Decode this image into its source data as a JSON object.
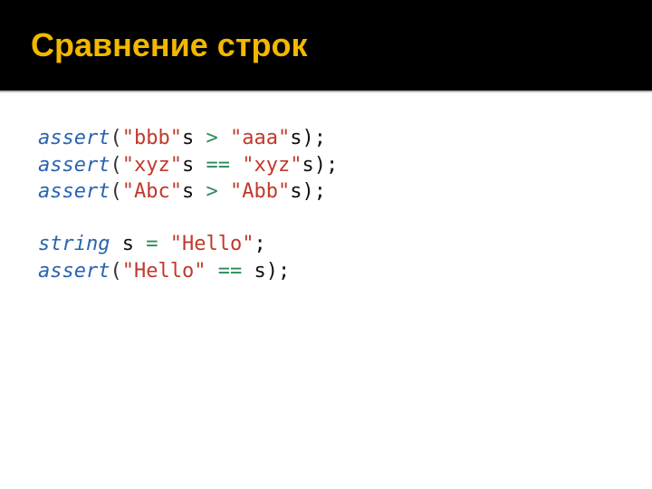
{
  "header": {
    "title": "Сравнение строк"
  },
  "code": {
    "l1": {
      "kw": "assert",
      "p1": "(",
      "s1": "\"bbb\"",
      "suf1": "s ",
      "op": ">",
      "sp": " ",
      "s2": "\"aaa\"",
      "suf2": "s);"
    },
    "l2": {
      "kw": "assert",
      "p1": "(",
      "s1": "\"xyz\"",
      "suf1": "s ",
      "op": "==",
      "sp": " ",
      "s2": "\"xyz\"",
      "suf2": "s);"
    },
    "l3": {
      "kw": "assert",
      "p1": "(",
      "s1": "\"Abc\"",
      "suf1": "s ",
      "op": ">",
      "sp": " ",
      "s2": "\"Abb\"",
      "suf2": "s);"
    },
    "l4": {
      "kw": "string",
      "sp1": " ",
      "id": "s",
      "sp2": " ",
      "op": "=",
      "sp3": " ",
      "s1": "\"Hello\"",
      "end": ";"
    },
    "l5": {
      "kw": "assert",
      "p1": "(",
      "s1": "\"Hello\"",
      "sp": " ",
      "op": "==",
      "sp2": " ",
      "id": "s",
      "end": ");"
    }
  }
}
